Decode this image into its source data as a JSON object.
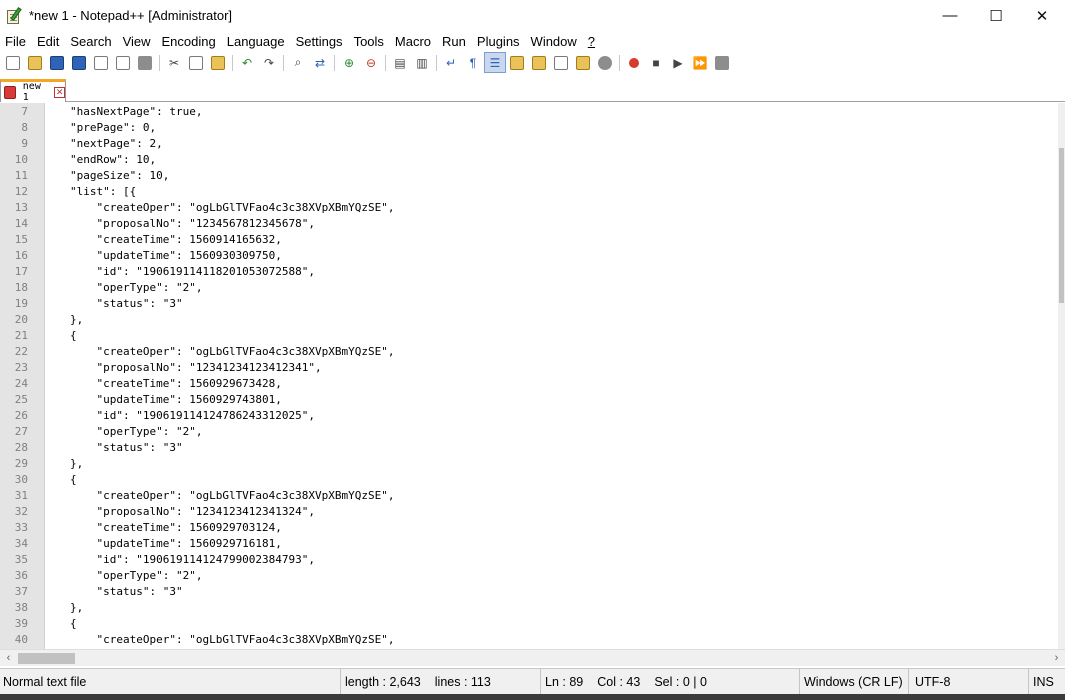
{
  "window": {
    "title": "*new 1 - Notepad++ [Administrator]",
    "controls": {
      "minimize": "—",
      "maximize": "☐",
      "close": "✕"
    }
  },
  "menu": [
    "File",
    "Edit",
    "Search",
    "View",
    "Encoding",
    "Language",
    "Settings",
    "Tools",
    "Macro",
    "Run",
    "Plugins",
    "Window",
    "?"
  ],
  "tab": {
    "label": "new 1",
    "close_glyph": "✕"
  },
  "editor": {
    "lines": [
      {
        "n": "7",
        "text": "\"hasNextPage\": true,"
      },
      {
        "n": "8",
        "text": "\"prePage\": 0,"
      },
      {
        "n": "9",
        "text": "\"nextPage\": 2,"
      },
      {
        "n": "10",
        "text": "\"endRow\": 10,"
      },
      {
        "n": "11",
        "text": "\"pageSize\": 10,"
      },
      {
        "n": "12",
        "text": "\"list\": [{"
      },
      {
        "n": "13",
        "text": "    \"createOper\": \"ogLbGlTVFao4c3c38XVpXBmYQzSE\","
      },
      {
        "n": "14",
        "text": "    \"proposalNo\": \"1234567812345678\","
      },
      {
        "n": "15",
        "text": "    \"createTime\": 1560914165632,"
      },
      {
        "n": "16",
        "text": "    \"updateTime\": 1560930309750,"
      },
      {
        "n": "17",
        "text": "    \"id\": \"190619114118201053072588\","
      },
      {
        "n": "18",
        "text": "    \"operType\": \"2\","
      },
      {
        "n": "19",
        "text": "    \"status\": \"3\""
      },
      {
        "n": "20",
        "text": "},"
      },
      {
        "n": "21",
        "text": "{"
      },
      {
        "n": "22",
        "text": "    \"createOper\": \"ogLbGlTVFao4c3c38XVpXBmYQzSE\","
      },
      {
        "n": "23",
        "text": "    \"proposalNo\": \"12341234123412341\","
      },
      {
        "n": "24",
        "text": "    \"createTime\": 1560929673428,"
      },
      {
        "n": "25",
        "text": "    \"updateTime\": 1560929743801,"
      },
      {
        "n": "26",
        "text": "    \"id\": \"190619114124786243312025\","
      },
      {
        "n": "27",
        "text": "    \"operType\": \"2\","
      },
      {
        "n": "28",
        "text": "    \"status\": \"3\""
      },
      {
        "n": "29",
        "text": "},"
      },
      {
        "n": "30",
        "text": "{"
      },
      {
        "n": "31",
        "text": "    \"createOper\": \"ogLbGlTVFao4c3c38XVpXBmYQzSE\","
      },
      {
        "n": "32",
        "text": "    \"proposalNo\": \"1234123412341324\","
      },
      {
        "n": "33",
        "text": "    \"createTime\": 1560929703124,"
      },
      {
        "n": "34",
        "text": "    \"updateTime\": 1560929716181,"
      },
      {
        "n": "35",
        "text": "    \"id\": \"190619114124799002384793\","
      },
      {
        "n": "36",
        "text": "    \"operType\": \"2\","
      },
      {
        "n": "37",
        "text": "    \"status\": \"3\""
      },
      {
        "n": "38",
        "text": "},"
      },
      {
        "n": "39",
        "text": "{"
      },
      {
        "n": "40",
        "text": "    \"createOper\": \"ogLbGlTVFao4c3c38XVpXBmYQzSE\","
      }
    ]
  },
  "status": {
    "file_type": "Normal text file",
    "length": "length : 2,643",
    "lines": "lines : 113",
    "ln": "Ln : 89",
    "col": "Col : 43",
    "sel": "Sel : 0 | 0",
    "eol": "Windows (CR LF)",
    "encoding": "UTF-8",
    "ins": "INS"
  }
}
